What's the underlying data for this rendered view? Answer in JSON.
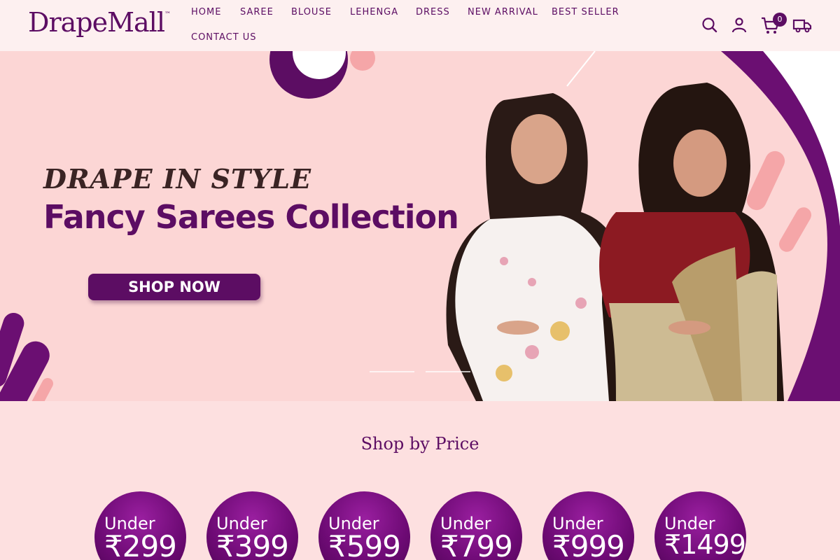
{
  "brand": {
    "name": "DrapeMall",
    "tm": "™"
  },
  "nav": [
    "HOME",
    "SAREE",
    "BLOUSE",
    "LEHENGA",
    "DRESS",
    "NEW ARRIVAL",
    "BEST SELLER",
    "CONTACT US"
  ],
  "cart": {
    "count": "0"
  },
  "icons": [
    "search-icon",
    "account-icon",
    "cart-icon",
    "delivery-truck-icon"
  ],
  "hero": {
    "tagline": "DRAPE IN STYLE",
    "headline": "Fancy Sarees Collection",
    "cta": "SHOP NOW"
  },
  "shop_by_price": {
    "title": "Shop by Price",
    "items": [
      {
        "prefix": "Under",
        "amount": "₹299"
      },
      {
        "prefix": "Under",
        "amount": "₹399"
      },
      {
        "prefix": "Under",
        "amount": "₹599"
      },
      {
        "prefix": "Under",
        "amount": "₹799"
      },
      {
        "prefix": "Under",
        "amount": "₹999"
      },
      {
        "prefix": "Under",
        "amount": "₹1499"
      }
    ]
  },
  "colors": {
    "brand": "#5c0d63",
    "header_bg": "#fdf0f0",
    "page_bg": "#fde0e0",
    "hero_bg": "#fcd6d5"
  }
}
